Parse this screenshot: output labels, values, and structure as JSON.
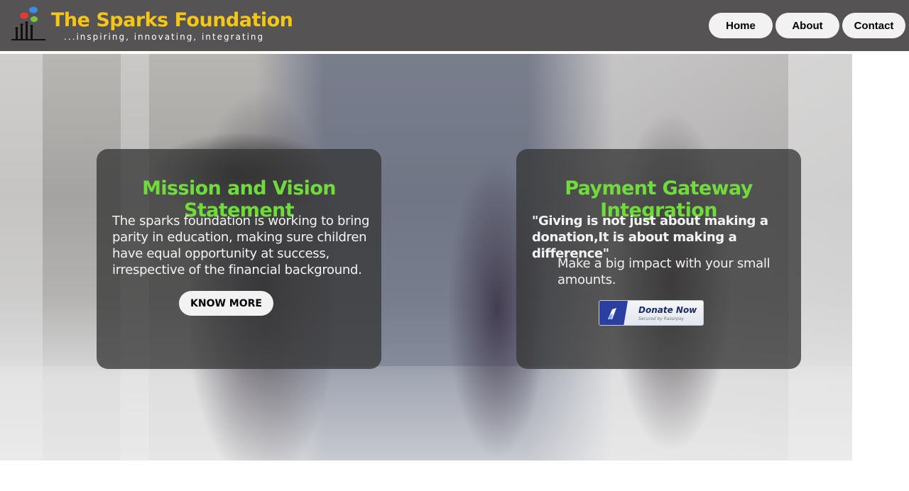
{
  "header": {
    "title": "The Sparks Foundation",
    "tagline": "...inspiring, innovating, integrating",
    "logo_icon": "sparks-logo"
  },
  "nav": {
    "items": [
      {
        "label": "Home"
      },
      {
        "label": "About"
      },
      {
        "label": "Contact"
      }
    ]
  },
  "mission_card": {
    "title": "Mission and Vision Statement",
    "body": "The sparks foundation is working to bring parity in education, making sure children have equal opportunity at success, irrespective of the financial background.",
    "button_label": "KNOW MORE"
  },
  "payment_card": {
    "title": "Payment Gateway Integration",
    "quote": "\"Giving is not just about making a donation,It is about making a difference\"",
    "impact": "Make a big impact with your small amounts.",
    "donate_label": "Donate Now",
    "donate_sub": "Secured by Razorpay"
  },
  "colors": {
    "header_bg": "#555353",
    "brand_yellow": "#f5c518",
    "title_green": "#6fdc3c",
    "razorpay_blue": "#2a3fa0"
  }
}
